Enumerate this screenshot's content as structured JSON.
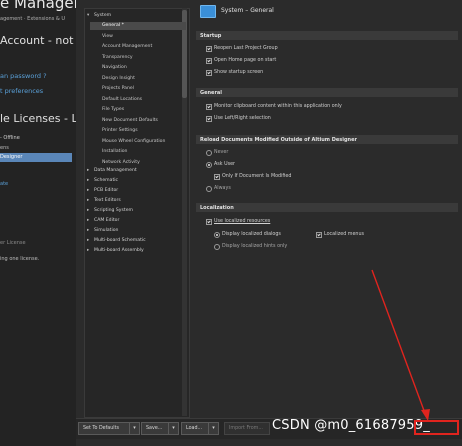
{
  "background_app": {
    "title": "e Managem",
    "breadcrumb": "agement  ·  Extensions & U",
    "account_heading": "Account - not sig",
    "link_password": "an password ?",
    "link_preferences": "t preferences",
    "licenses_heading": "le Licenses - Lice",
    "offline_label": "- Offline",
    "row1": "ens",
    "selected_row": "Designer",
    "right_link": "ate",
    "license_label": "er License",
    "use_license": "ing one license."
  },
  "dialog": {
    "header_title": "System – General",
    "tree": {
      "system_label": "System",
      "system_children": [
        "General *",
        "View",
        "Account Management",
        "Transparency",
        "Navigation",
        "Design Insight",
        "Projects Panel",
        "Default Locations",
        "File Types",
        "New Document Defaults",
        "Printer Settings",
        "Mouse Wheel Configuration",
        "Installation",
        "Network Activity"
      ],
      "other_nodes": [
        "Data Management",
        "Schematic",
        "PCB Editor",
        "Text Editors",
        "Scripting System",
        "CAM Editor",
        "Simulation",
        "Multi-board Schematic",
        "Multi-board Assembly"
      ]
    },
    "sections": {
      "startup": {
        "title": "Startup",
        "items": [
          "Reopen Last Project Group",
          "Open Home page on start",
          "Show startup screen"
        ]
      },
      "general": {
        "title": "General",
        "items": [
          "Monitor clipboard content within this application only",
          "Use Left/Right selection"
        ]
      },
      "reload": {
        "title": "Reload Documents Modified Outside of Altium Designer",
        "never": "Never",
        "ask_user": "Ask User",
        "only_if_modified": "Only If Document Is Modified",
        "always": "Always"
      },
      "localization": {
        "title": "Localization",
        "use_localized": "Use localized resources",
        "display_dialogs": "Display localized dialogs",
        "localized_menus": "Localized menus",
        "display_hints": "Display localized hints only"
      }
    },
    "buttons": {
      "set_defaults": "Set To Defaults",
      "save": "Save...",
      "load": "Load...",
      "import": "Import From..."
    }
  },
  "watermark": "CSDN @m0_61687959_",
  "colors": {
    "accent_red": "#e0241e",
    "selection_blue": "#5a86b8",
    "link_blue": "#5aa0d8"
  }
}
